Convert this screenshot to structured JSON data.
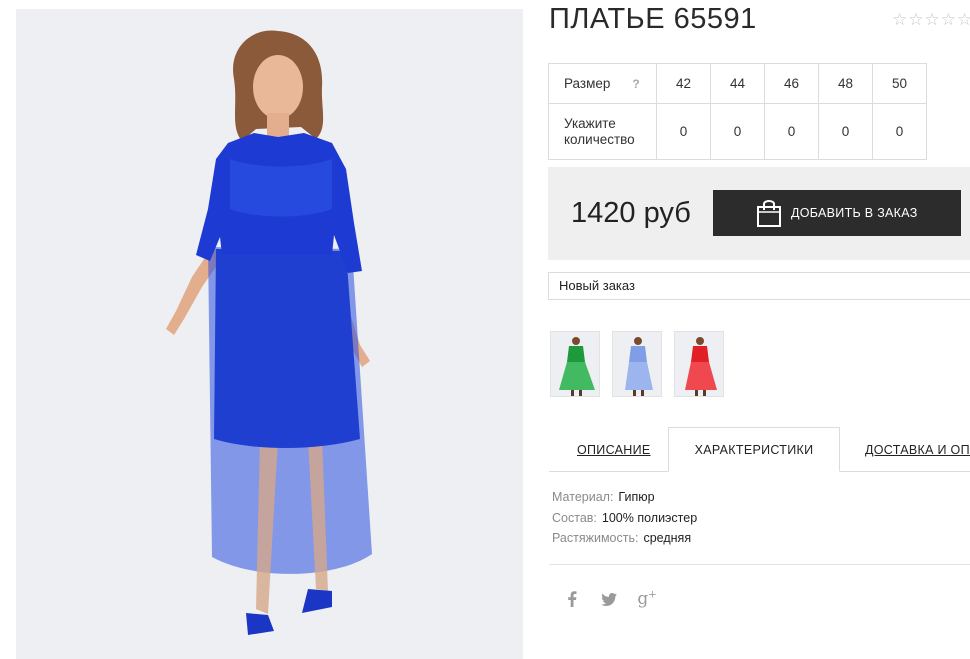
{
  "product": {
    "title": "ПЛАТЬЕ 65591",
    "rating_stars": 5,
    "rating_filled": 0
  },
  "sizes": {
    "size_label": "Размер",
    "help": "?",
    "qty_label": "Укажите количество",
    "items": [
      {
        "size": "42",
        "qty": "0"
      },
      {
        "size": "44",
        "qty": "0"
      },
      {
        "size": "46",
        "qty": "0"
      },
      {
        "size": "48",
        "qty": "0"
      },
      {
        "size": "50",
        "qty": "0"
      }
    ]
  },
  "purchase": {
    "price": "1420 руб",
    "add_button": "ДОБАВИТЬ В ЗАКАЗ",
    "order_select": "Новый заказ"
  },
  "color_variants": [
    "green",
    "light-blue",
    "red"
  ],
  "tabs": [
    {
      "label": "ОПИСАНИЕ",
      "active": false
    },
    {
      "label": "ХАРАКТЕРИСТИКИ",
      "active": true
    },
    {
      "label": "ДОСТАВКА И ОПЛ",
      "active": false
    }
  ],
  "specs": [
    {
      "key": "Материал:",
      "value": "Гипюр"
    },
    {
      "key": "Состав:",
      "value": "100% полиэстер"
    },
    {
      "key": "Растяжимость:",
      "value": "средняя"
    }
  ],
  "social": [
    {
      "icon": "facebook-icon",
      "glyph": "f"
    },
    {
      "icon": "twitter-icon",
      "glyph": "t"
    },
    {
      "icon": "google-plus-icon",
      "glyph": "g+"
    }
  ],
  "colors": {
    "dress": "#1f3fd0",
    "button": "#2c2c2c",
    "price_bg": "#efefef"
  }
}
